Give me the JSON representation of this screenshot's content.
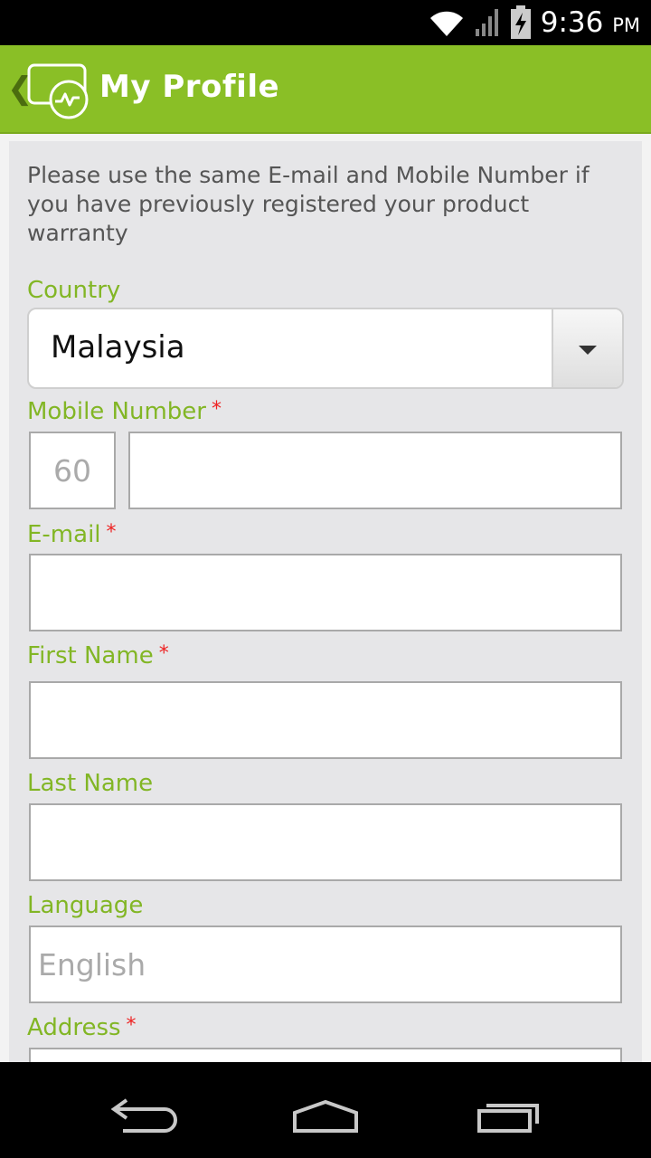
{
  "status_bar": {
    "time": "9:36",
    "ampm": "PM",
    "icons": [
      "wifi-icon",
      "signal-icon",
      "battery-charging-icon"
    ]
  },
  "action_bar": {
    "title": "My Profile",
    "back_icon": "back-chevron-icon",
    "logo_icon": "app-logo-icon"
  },
  "form": {
    "intro": "Please use the same E-mail and Mobile Number if you have previously registered your product warranty",
    "country": {
      "label": "Country",
      "value": "Malaysia"
    },
    "mobile": {
      "label": "Mobile Number",
      "required_mark": "*",
      "country_code": "60",
      "value": ""
    },
    "email": {
      "label": "E-mail",
      "required_mark": "*",
      "value": ""
    },
    "first_name": {
      "label": "First Name",
      "required_mark": "*",
      "value": ""
    },
    "last_name": {
      "label": "Last Name",
      "value": ""
    },
    "language": {
      "label": "Language",
      "value": "English"
    },
    "address": {
      "label": "Address",
      "required_mark": "*",
      "value": ""
    }
  },
  "nav_bar": {
    "icons": [
      "back-nav-icon",
      "home-nav-icon",
      "recent-apps-icon"
    ]
  },
  "colors": {
    "accent": "#8abf26",
    "label": "#82b625",
    "required": "#e22222"
  }
}
